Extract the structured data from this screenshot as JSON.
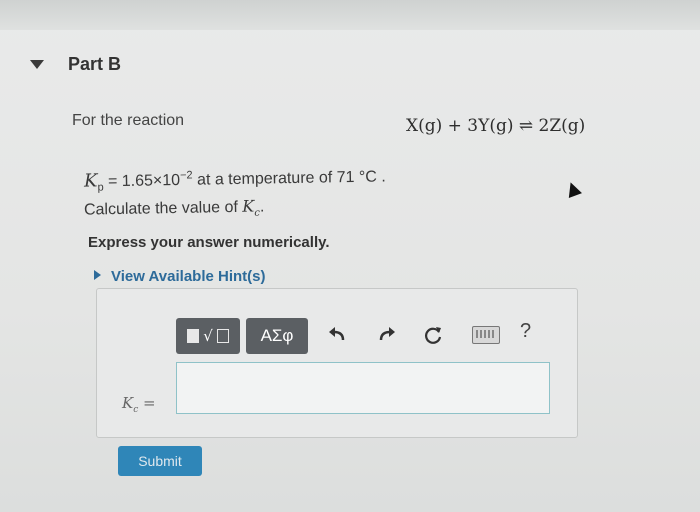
{
  "part": {
    "title": "Part B"
  },
  "question": {
    "reaction_label": "For the reaction",
    "equation": "X(g) + 3Y(g) ⇌ 2Z(g)",
    "kp_symbol": "K",
    "kp_subscript": "p",
    "kp_value_text": " = 1.65×10",
    "kp_exponent": "−2",
    "kp_suffix": " at a temperature of 71 °C .",
    "calculate_text": "Calculate the value of ",
    "kc_symbol": "K",
    "kc_subscript": "c",
    "calculate_end": ".",
    "instruction": "Express your answer numerically.",
    "hint_link": "View Available Hint(s)"
  },
  "toolbar": {
    "greek_label": "ΑΣφ",
    "help_label": "?",
    "icons": [
      "templates-icon",
      "greek-icon",
      "undo-icon",
      "redo-icon",
      "reset-icon",
      "keyboard-icon",
      "help-icon"
    ]
  },
  "answer": {
    "label_symbol": "K",
    "label_subscript": "c",
    "label_equals": " =",
    "value": ""
  },
  "submit": {
    "label": "Submit"
  },
  "colors": {
    "link": "#2d6b9a",
    "submit": "#2f86b8",
    "toolbar_button": "#5b5f63",
    "input_border": "#8fc2c8"
  }
}
